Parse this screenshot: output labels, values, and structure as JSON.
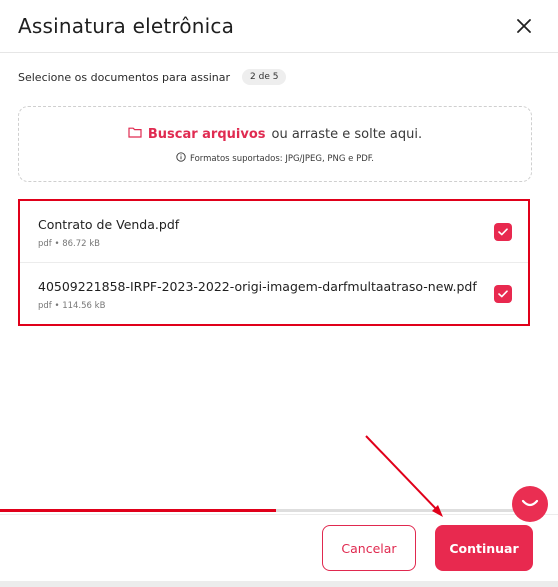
{
  "modal": {
    "title": "Assinatura eletrônica",
    "close_icon": "close-icon"
  },
  "subheader": {
    "label": "Selecione os documentos para assinar",
    "count_badge": "2 de 5"
  },
  "dropzone": {
    "icon": "folder-icon",
    "link_label": "Buscar arquivos",
    "suffix": "ou arraste e solte aqui.",
    "info_icon": "info-icon",
    "formats_note": "Formatos suportados: JPG/JPEG, PNG e PDF."
  },
  "files": [
    {
      "name": "Contrato de Venda.pdf",
      "meta": "pdf • 86.72 kB",
      "checked": true
    },
    {
      "name": "40509221858-IRPF-2023-2022-origi-imagem-darfmultaatraso-new.pdf",
      "meta": "pdf • 114.56 kB",
      "checked": true
    }
  ],
  "progress": {
    "fraction": 0.53
  },
  "footer": {
    "cancel_label": "Cancelar",
    "continue_label": "Continuar"
  },
  "colors": {
    "accent": "#e8294f",
    "annotation_red": "#e0001a"
  }
}
